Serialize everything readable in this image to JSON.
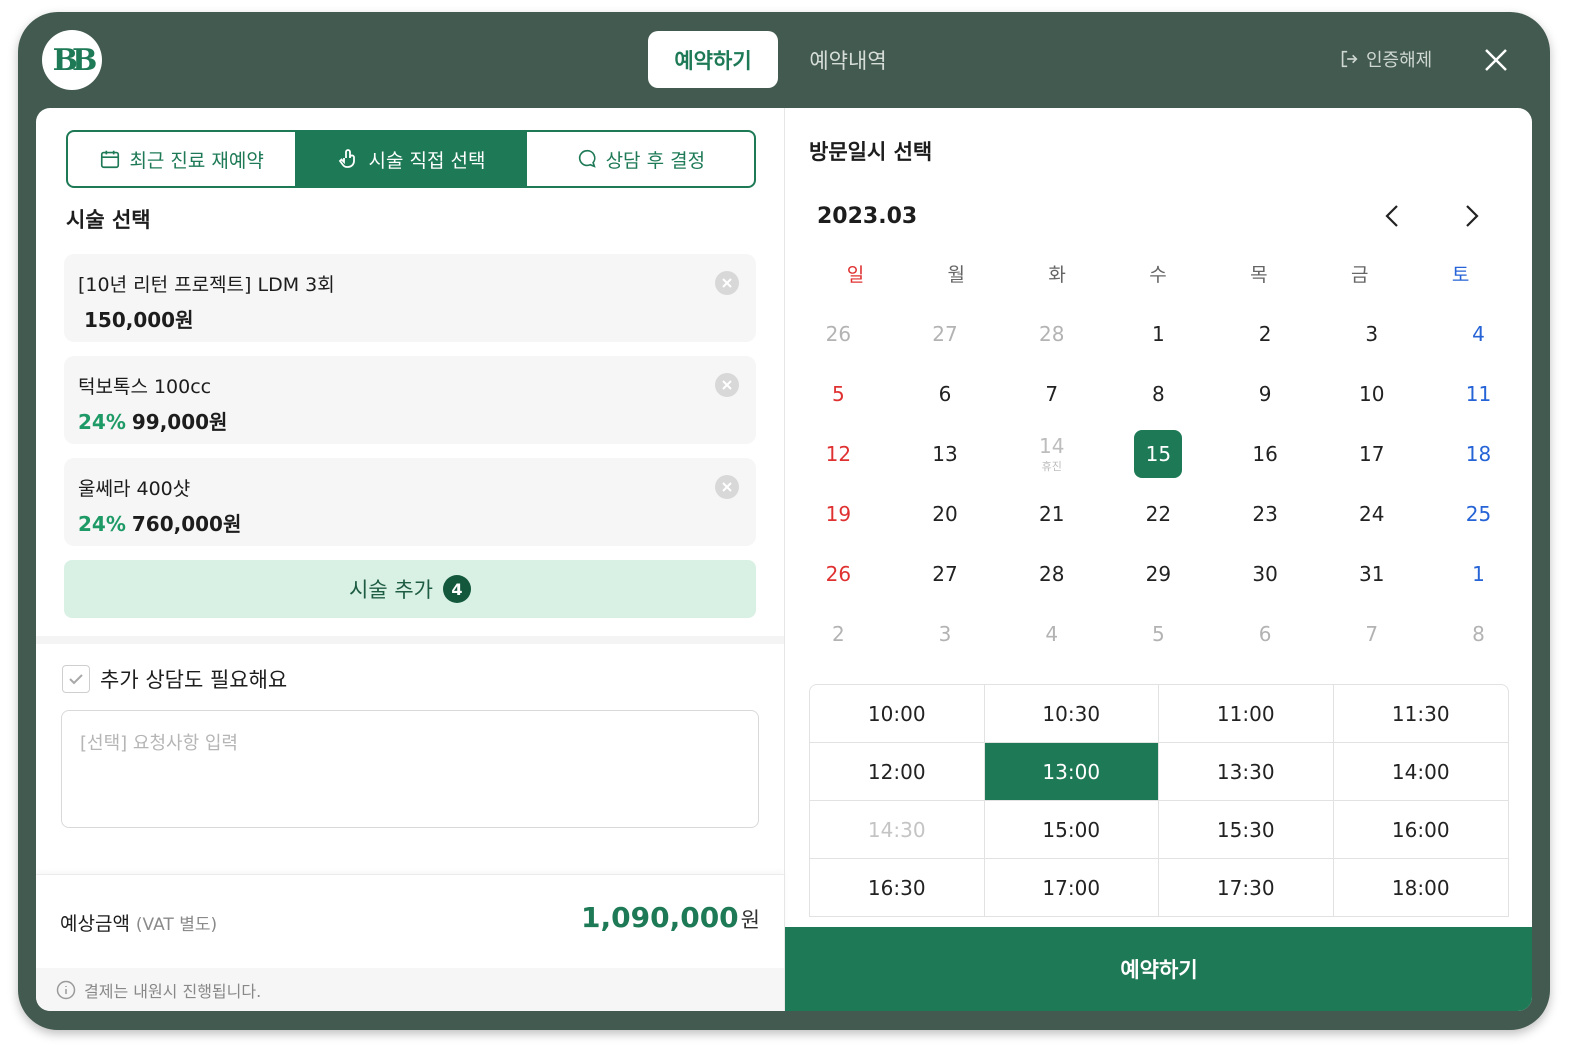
{
  "header": {
    "logo_text": "BB",
    "tabs": [
      {
        "label": "예약하기",
        "active": true
      },
      {
        "label": "예약내역",
        "active": false
      }
    ],
    "logout_label": "인증해제"
  },
  "left": {
    "mode_tabs": [
      {
        "label": "최근 진료 재예약",
        "icon": "calendar-icon",
        "active": false
      },
      {
        "label": "시술 직접 선택",
        "icon": "tap-icon",
        "active": true
      },
      {
        "label": "상담 후 결정",
        "icon": "chat-icon",
        "active": false
      }
    ],
    "section_title": "시술 선택",
    "items": [
      {
        "name": "[10년 리턴 프로젝트] LDM 3회",
        "discount": "",
        "price": "150,000원"
      },
      {
        "name": "턱보톡스 100cc",
        "discount": "24%",
        "price": "99,000원"
      },
      {
        "name": "울쎄라 400샷",
        "discount": "24%",
        "price": "760,000원"
      }
    ],
    "add_button": {
      "label": "시술 추가",
      "count": "4"
    },
    "consult_label": "추가 상담도 필요해요",
    "request_placeholder": "[선택] 요청사항 입력",
    "summary": {
      "label": "예상금액",
      "vat": "(VAT 별도)",
      "total": "1,090,000",
      "unit": "원"
    },
    "notice": "결제는 내원시 진행됩니다."
  },
  "right": {
    "title": "방문일시 선택",
    "month": "2023.03",
    "weekdays": [
      "일",
      "월",
      "화",
      "수",
      "목",
      "금",
      "토"
    ],
    "weeks": [
      [
        {
          "d": "26",
          "m": true
        },
        {
          "d": "27",
          "m": true
        },
        {
          "d": "28",
          "m": true
        },
        {
          "d": "1"
        },
        {
          "d": "2"
        },
        {
          "d": "3"
        },
        {
          "d": "4"
        }
      ],
      [
        {
          "d": "5"
        },
        {
          "d": "6"
        },
        {
          "d": "7"
        },
        {
          "d": "8"
        },
        {
          "d": "9"
        },
        {
          "d": "10"
        },
        {
          "d": "11"
        }
      ],
      [
        {
          "d": "12"
        },
        {
          "d": "13"
        },
        {
          "d": "14",
          "off": true,
          "note": "휴진"
        },
        {
          "d": "15",
          "sel": true
        },
        {
          "d": "16"
        },
        {
          "d": "17"
        },
        {
          "d": "18"
        }
      ],
      [
        {
          "d": "19"
        },
        {
          "d": "20"
        },
        {
          "d": "21"
        },
        {
          "d": "22"
        },
        {
          "d": "23"
        },
        {
          "d": "24"
        },
        {
          "d": "25"
        }
      ],
      [
        {
          "d": "26"
        },
        {
          "d": "27"
        },
        {
          "d": "28"
        },
        {
          "d": "29"
        },
        {
          "d": "30"
        },
        {
          "d": "31"
        },
        {
          "d": "1"
        }
      ],
      [
        {
          "d": "2",
          "m": true
        },
        {
          "d": "3",
          "m": true
        },
        {
          "d": "4",
          "m": true
        },
        {
          "d": "5",
          "m": true
        },
        {
          "d": "6",
          "m": true
        },
        {
          "d": "7",
          "m": true
        },
        {
          "d": "8",
          "m": true
        }
      ]
    ],
    "times": [
      {
        "t": "10:00"
      },
      {
        "t": "10:30"
      },
      {
        "t": "11:00"
      },
      {
        "t": "11:30"
      },
      {
        "t": "12:00"
      },
      {
        "t": "13:00",
        "sel": true
      },
      {
        "t": "13:30"
      },
      {
        "t": "14:00"
      },
      {
        "t": "14:30",
        "dis": true
      },
      {
        "t": "15:00"
      },
      {
        "t": "15:30"
      },
      {
        "t": "16:00"
      },
      {
        "t": "16:30"
      },
      {
        "t": "17:00"
      },
      {
        "t": "17:30"
      },
      {
        "t": "18:00"
      }
    ],
    "book_label": "예약하기"
  },
  "colors": {
    "primary": "#1e7a56",
    "frame": "#425a4f",
    "sunday": "#e03131",
    "saturday": "#2563d6",
    "add_bg": "#d9f1e4"
  }
}
